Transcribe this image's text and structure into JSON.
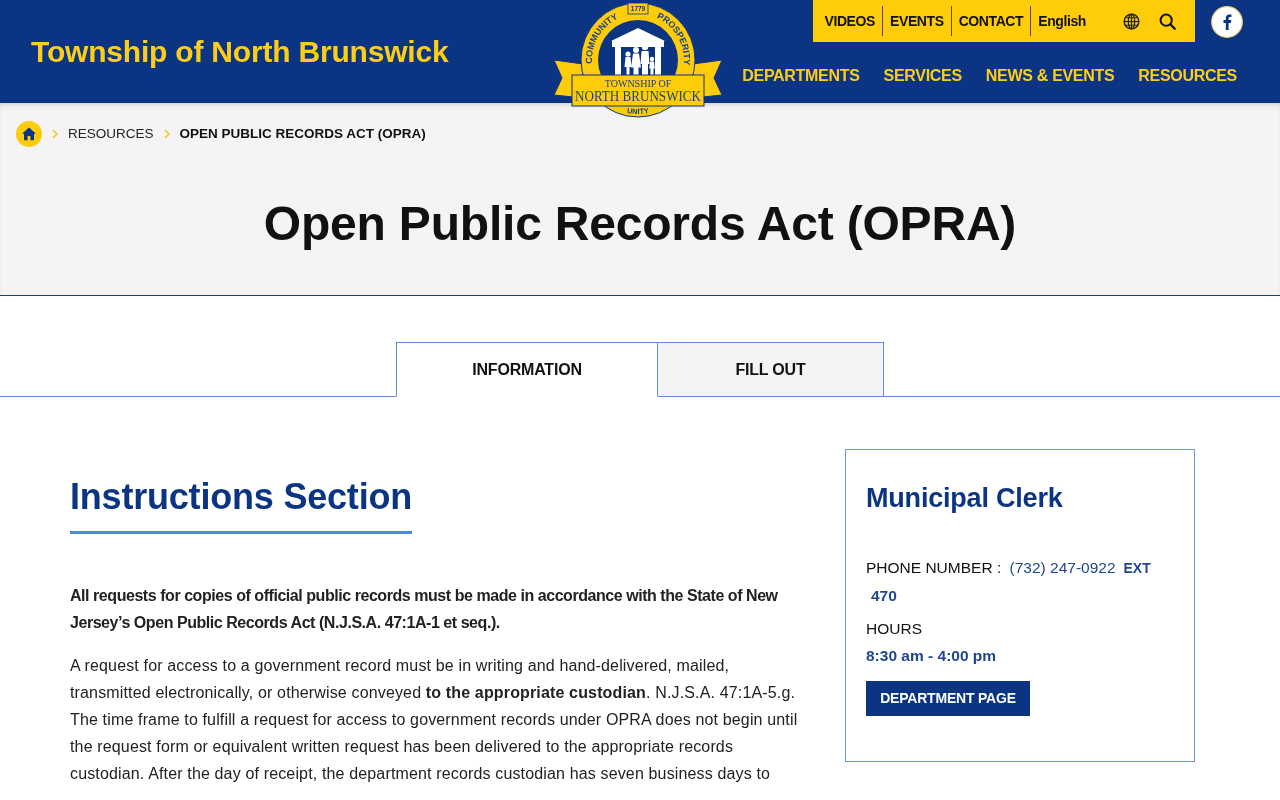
{
  "header": {
    "site_title": "Township of North Brunswick",
    "logo": {
      "arc_left": "COMMUNITY",
      "year": "1779",
      "arc_right": "PROSPERITY",
      "banner_top": "TOWNSHIP OF",
      "banner_bottom": "NORTH BRUNSWICK",
      "arc_bottom": "UNITY"
    },
    "utility_links": [
      "VIDEOS",
      "EVENTS",
      "CONTACT"
    ],
    "language": "English",
    "main_nav": [
      "DEPARTMENTS",
      "SERVICES",
      "NEWS & EVENTS",
      "RESOURCES"
    ]
  },
  "breadcrumb": [
    {
      "label": "RESOURCES",
      "current": false
    },
    {
      "label": "OPEN PUBLIC RECORDS ACT (OPRA)",
      "current": true
    }
  ],
  "page_title": "Open Public Records Act (OPRA)",
  "tabs": [
    {
      "label": "INFORMATION",
      "selected": true
    },
    {
      "label": "FILL OUT",
      "selected": false
    }
  ],
  "content": {
    "heading": "Instructions Section",
    "paragraphs": [
      {
        "kind": "bold",
        "text": "All requests for copies of official public records must be made in accordance with the State of New Jersey’s Open Public Records Act (N.J.S.A. 47:1A-1 et seq.)."
      },
      {
        "kind": "normal",
        "text": "A request for access to a government record must be in writing and hand-delivered, mailed, transmitted electronically, or otherwise conveyed **to the appropriate custodian**. N.J.S.A. 47:1A-5.g. The time frame to fulfill a request for access to government records under OPRA does not begin until the request form or equivalent written request has been delivered to the appropriate records custodian. After the day of receipt, the department records custodian has seven business days to"
      }
    ]
  },
  "contact_card": {
    "title": "Municipal Clerk",
    "phone_label": "PHONE NUMBER :",
    "phone": "(732) 247-0922",
    "ext_label": "EXT",
    "ext": "470",
    "hours_label": "HOURS",
    "hours": "8:30 am - 4:00 pm",
    "button": "DEPARTMENT PAGE"
  }
}
